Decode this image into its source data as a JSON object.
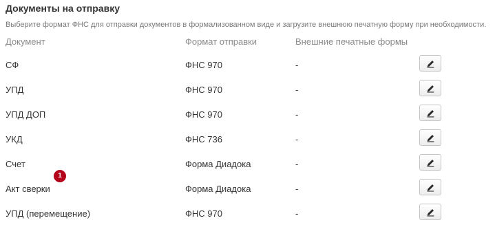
{
  "section": {
    "title": "Документы на отправку",
    "subtitle": "Выберите формат ФНС для отправки документов в формализованном виде и загрузите внешнюю печатную форму при необходимости."
  },
  "columns": {
    "document": "Документ",
    "format": "Формат отправки",
    "print_forms": "Внешние печатные формы"
  },
  "rows": [
    {
      "document": "СФ",
      "format": "ФНС 970",
      "print_forms": "-"
    },
    {
      "document": "УПД",
      "format": "ФНС 970",
      "print_forms": "-"
    },
    {
      "document": "УПД ДОП",
      "format": "ФНС 970",
      "print_forms": "-"
    },
    {
      "document": "УКД",
      "format": "ФНС 736",
      "print_forms": "-"
    },
    {
      "document": "Счет",
      "format": "Форма Диадока",
      "print_forms": "-"
    },
    {
      "document": "Акт сверки",
      "format": "Форма Диадока",
      "print_forms": "-",
      "badge": "1"
    },
    {
      "document": "УПД (перемещение)",
      "format": "ФНС 970",
      "print_forms": "-"
    }
  ],
  "icons": {
    "edit": "pencil-icon"
  },
  "colors": {
    "badge": "#b3001b",
    "header_text": "#8a8a8a",
    "subtitle_text": "#7b7b7b"
  }
}
